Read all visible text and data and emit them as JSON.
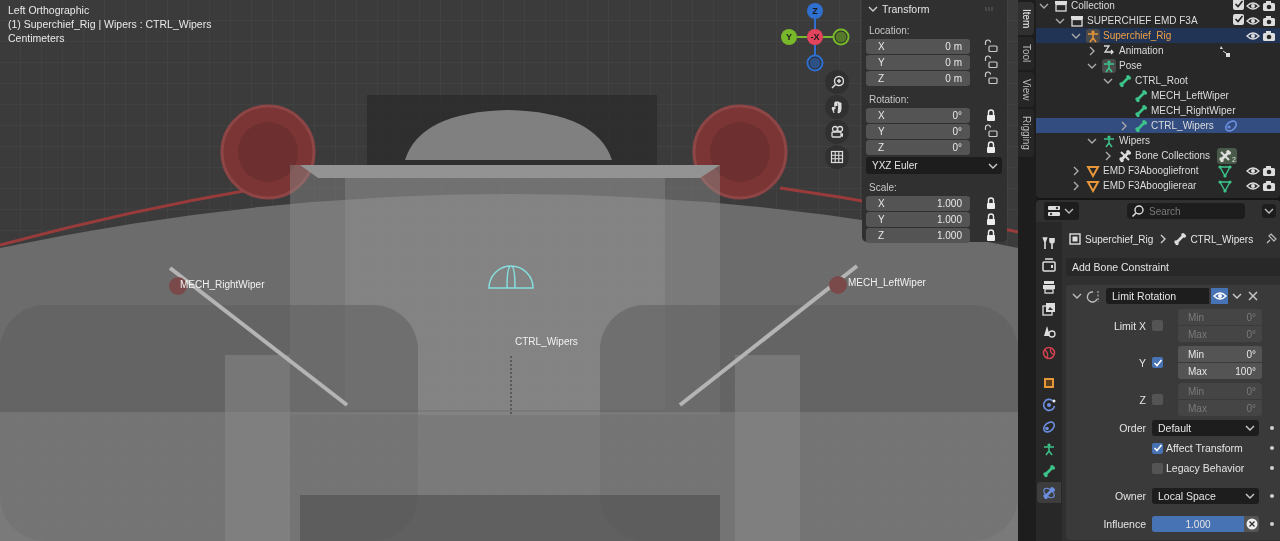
{
  "viewport": {
    "overlay_text": [
      "Left Orthographic",
      "(1) Superchief_Rig | Wipers : CTRL_Wipers",
      "Centimeters"
    ],
    "gizmo_axes": [
      {
        "label": "Z",
        "color": "#2f6fd0"
      },
      {
        "label": "Y",
        "color": "#78b82a"
      },
      {
        "label": "-X",
        "color": "#e2445e"
      }
    ],
    "bone_labels": [
      "MECH_RightWiper",
      "MECH_LeftWiper",
      "CTRL_Wipers"
    ],
    "nav_buttons": [
      {
        "kind": "zoom"
      },
      {
        "kind": "pan"
      },
      {
        "kind": "camera"
      },
      {
        "kind": "grid"
      }
    ],
    "transform_panel": {
      "title": "Transform",
      "groups": [
        {
          "label": "Location:",
          "rows": [
            {
              "axis": "X",
              "value": "0 m",
              "locked": false
            },
            {
              "axis": "Y",
              "value": "0 m",
              "locked": false
            },
            {
              "axis": "Z",
              "value": "0 m",
              "locked": false
            }
          ]
        },
        {
          "label": "Rotation:",
          "rows": [
            {
              "axis": "X",
              "value": "0°",
              "locked": true
            },
            {
              "axis": "Y",
              "value": "0°",
              "locked": false
            },
            {
              "axis": "Z",
              "value": "0°",
              "locked": true
            }
          ],
          "mode": "YXZ Euler"
        },
        {
          "label": "Scale:",
          "rows": [
            {
              "axis": "X",
              "value": "1.000",
              "locked": true
            },
            {
              "axis": "Y",
              "value": "1.000",
              "locked": true
            },
            {
              "axis": "Z",
              "value": "1.000",
              "locked": true
            }
          ]
        }
      ]
    }
  },
  "sidebar_tabs": [
    {
      "label": "Item",
      "selected": true
    },
    {
      "label": "Tool",
      "selected": false
    },
    {
      "label": "View",
      "selected": false
    },
    {
      "label": "Rigging",
      "selected": false
    }
  ],
  "outliner": {
    "rows": [
      {
        "name": "Collection",
        "kind": "collection",
        "expanded": true,
        "selected": false,
        "active": false,
        "checked": true,
        "visible": true,
        "children": [
          {
            "name": "SUPERCHIEF EMD F3A",
            "kind": "collection",
            "expanded": true,
            "selected": false,
            "active": false,
            "checked": true,
            "visible": true,
            "children": [
              {
                "name": "Superchief_Rig",
                "kind": "armature_object",
                "expanded": true,
                "selected": true,
                "active": true,
                "checked": false,
                "visible": true,
                "children": [
                  {
                    "name": "Animation",
                    "kind": "animation",
                    "expanded": false,
                    "selected": false,
                    "active": false,
                    "checked": false,
                    "visible": false,
                    "badge": {
                      "kind": "action"
                    }
                  },
                  {
                    "name": "Pose",
                    "kind": "pose",
                    "expanded": true,
                    "selected": false,
                    "active": false,
                    "checked": false,
                    "visible": false,
                    "children": [
                      {
                        "name": "CTRL_Root",
                        "kind": "bone",
                        "expanded": true,
                        "selected": false,
                        "active": false,
                        "checked": false,
                        "visible": false,
                        "children": [
                          {
                            "name": "MECH_LeftWiper",
                            "kind": "bone",
                            "selected": false,
                            "active": false,
                            "checked": false,
                            "visible": false
                          },
                          {
                            "name": "MECH_RightWiper",
                            "kind": "bone",
                            "selected": false,
                            "active": false,
                            "checked": false,
                            "visible": false
                          },
                          {
                            "name": "CTRL_Wipers",
                            "kind": "bone",
                            "expanded": false,
                            "selected": true,
                            "active": false,
                            "checked": false,
                            "visible": false,
                            "badge": {
                              "kind": "constraint"
                            }
                          }
                        ]
                      }
                    ]
                  },
                  {
                    "name": "Wipers",
                    "kind": "armature_data",
                    "expanded": true,
                    "selected": false,
                    "active": false,
                    "checked": false,
                    "visible": false,
                    "children": [
                      {
                        "name": "Bone Collections",
                        "kind": "bone_collections",
                        "expanded": false,
                        "selected": false,
                        "active": false,
                        "checked": false,
                        "visible": false,
                        "badge": {
                          "kind": "bone_collections",
                          "count": "2"
                        }
                      }
                    ]
                  }
                ]
              },
              {
                "name": "EMD F3Aboogliefront",
                "kind": "mesh_object",
                "expanded": false,
                "selected": false,
                "active": false,
                "checked": false,
                "visible": true,
                "badge": {
                  "kind": "vertex_groups"
                }
              },
              {
                "name": "EMD F3Abooglierear",
                "kind": "mesh_object",
                "expanded": false,
                "selected": false,
                "active": false,
                "checked": false,
                "visible": true,
                "badge": {
                  "kind": "vertex_groups"
                }
              }
            ]
          }
        ]
      }
    ]
  },
  "properties": {
    "search": {
      "placeholder": "Search"
    },
    "tabs": [
      {
        "kind": "tool",
        "selected": false
      },
      {
        "kind": "render",
        "selected": false
      },
      {
        "kind": "output",
        "selected": false
      },
      {
        "kind": "view_layer",
        "selected": false
      },
      {
        "kind": "scene",
        "selected": false
      },
      {
        "kind": "world",
        "selected": false
      },
      {
        "kind": "object",
        "selected": false
      },
      {
        "kind": "physics",
        "selected": false
      },
      {
        "kind": "object_constraint",
        "selected": false
      },
      {
        "kind": "armature",
        "selected": false
      },
      {
        "kind": "bone",
        "selected": false
      },
      {
        "kind": "bone_constraint",
        "selected": true
      }
    ],
    "breadcrumb": [
      "Superchief_Rig",
      "CTRL_Wipers"
    ],
    "add_menu": "Add Bone Constraint",
    "constraint": {
      "name": "Limit Rotation",
      "expanded": true,
      "enabled": true,
      "limits": [
        {
          "label": "Limit X",
          "checked": false,
          "min_label": "Min",
          "min": "0°",
          "max_label": "Max",
          "max": "0°"
        },
        {
          "label": "Y",
          "checked": true,
          "min_label": "Min",
          "min": "0°",
          "max_label": "Max",
          "max": "100°"
        },
        {
          "label": "Z",
          "checked": false,
          "min_label": "Min",
          "min": "0°",
          "max_label": "Max",
          "max": "0°"
        }
      ],
      "order": {
        "label": "Order",
        "value": "Default"
      },
      "options": [
        {
          "label": "Affect Transform",
          "checked": true
        },
        {
          "label": "Legacy Behavior",
          "checked": false
        }
      ],
      "owner": {
        "label": "Owner",
        "value": "Local Space"
      },
      "influence": {
        "label": "Influence",
        "value": "1.000",
        "level": 1
      }
    }
  }
}
